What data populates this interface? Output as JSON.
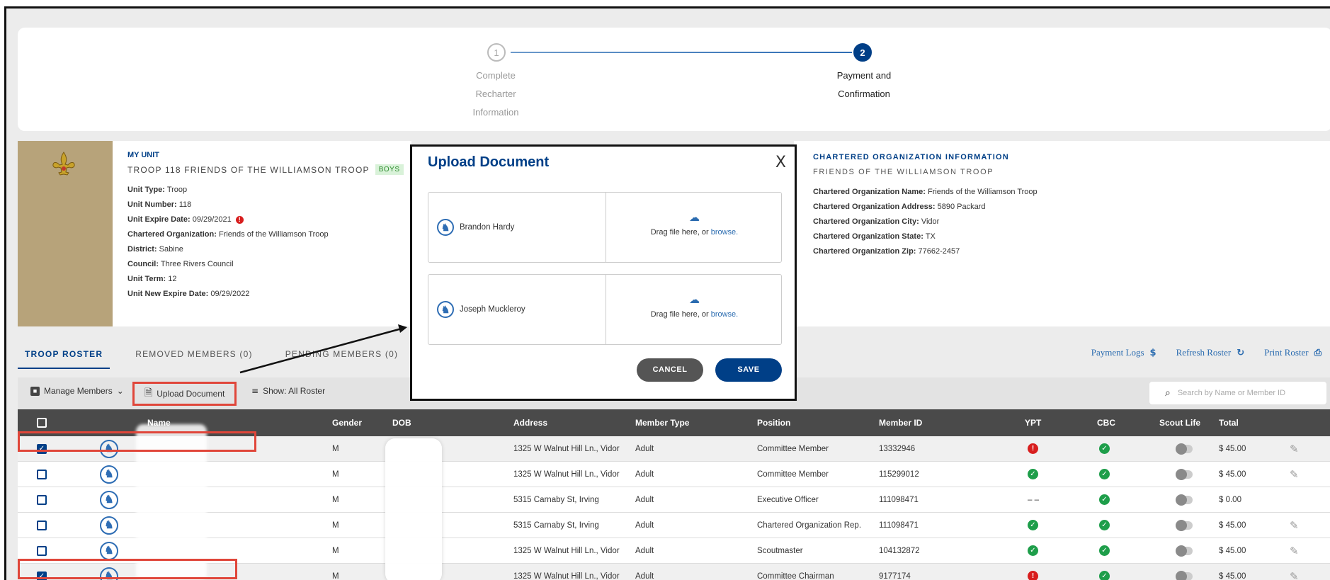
{
  "stepper": {
    "steps": [
      {
        "num": "1",
        "label": "Complete\nRecharter\nInformation"
      },
      {
        "num": "2",
        "label": "Payment and\nConfirmation"
      }
    ]
  },
  "unit": {
    "heading": "MY UNIT",
    "title": "TROOP 118 FRIENDS OF THE WILLIAMSON TROOP",
    "badge": "BOYS",
    "fields": [
      {
        "k": "Unit Type:",
        "v": "Troop"
      },
      {
        "k": "Unit Number:",
        "v": "118"
      },
      {
        "k": "Unit Expire Date:",
        "v": "09/29/2021"
      },
      {
        "k": "Chartered Organization:",
        "v": "Friends of the Williamson Troop"
      },
      {
        "k": "District:",
        "v": "Sabine"
      },
      {
        "k": "Council:",
        "v": "Three Rivers Council"
      },
      {
        "k": "Unit Term:",
        "v": "12"
      },
      {
        "k": "Unit New Expire Date:",
        "v": "09/29/2022"
      }
    ]
  },
  "org": {
    "heading": "CHARTERED ORGANIZATION INFORMATION",
    "subtitle": "FRIENDS OF THE WILLIAMSON TROOP",
    "fields": [
      {
        "k": "Chartered Organization Name:",
        "v": "Friends of the Williamson Troop"
      },
      {
        "k": "Chartered Organization Address:",
        "v": "5890 Packard"
      },
      {
        "k": "Chartered Organization City:",
        "v": "Vidor"
      },
      {
        "k": "Chartered Organization State:",
        "v": "TX"
      },
      {
        "k": "Chartered Organization Zip:",
        "v": "77662-2457"
      }
    ]
  },
  "tabs": {
    "roster": "TROOP ROSTER",
    "removed": "REMOVED MEMBERS (0)",
    "pending": "PENDING MEMBERS (0)"
  },
  "links": {
    "payment_logs": "Payment Logs",
    "refresh_roster": "Refresh Roster",
    "print_roster": "Print Roster"
  },
  "toolbar": {
    "manage_members": "Manage Members",
    "upload_document": "Upload Document",
    "show_roster": "Show: All Roster",
    "search_placeholder": "Search by Name or Member ID"
  },
  "table": {
    "headers": [
      "Name",
      "Gender",
      "DOB",
      "Address",
      "Member Type",
      "Position",
      "Member ID",
      "YPT",
      "CBC",
      "Scout Life",
      "Total"
    ],
    "rows": [
      {
        "checked": true,
        "gender": "M",
        "address": "1325 W Walnut Hill Ln., Vidor",
        "type": "Adult",
        "position": "Committee Member",
        "id": "13332946",
        "ypt": "bad",
        "cbc": "ok",
        "total": "$ 45.00",
        "edit": true
      },
      {
        "checked": false,
        "gender": "M",
        "address": "1325 W Walnut Hill Ln., Vidor",
        "type": "Adult",
        "position": "Committee Member",
        "id": "115299012",
        "ypt": "ok",
        "cbc": "ok",
        "total": "$ 45.00",
        "edit": true
      },
      {
        "checked": false,
        "gender": "M",
        "address": "5315 Carnaby St, Irving",
        "type": "Adult",
        "position": "Executive Officer",
        "id": "111098471",
        "ypt": "dash",
        "cbc": "ok",
        "total": "$ 0.00",
        "edit": false
      },
      {
        "checked": false,
        "gender": "M",
        "address": "5315 Carnaby St, Irving",
        "type": "Adult",
        "position": "Chartered Organization Rep.",
        "id": "111098471",
        "ypt": "ok",
        "cbc": "ok",
        "total": "$ 45.00",
        "edit": true
      },
      {
        "checked": false,
        "gender": "M",
        "address": "1325 W Walnut Hill Ln., Vidor",
        "type": "Adult",
        "position": "Scoutmaster",
        "id": "104132872",
        "ypt": "ok",
        "cbc": "ok",
        "total": "$ 45.00",
        "edit": true
      },
      {
        "checked": true,
        "gender": "M",
        "address": "1325 W Walnut Hill Ln., Vidor",
        "type": "Adult",
        "position": "Committee Chairman",
        "id": "9177174",
        "ypt": "bad",
        "cbc": "ok",
        "total": "$ 45.00",
        "edit": true
      }
    ],
    "ypt_dash": "– –"
  },
  "modal": {
    "title": "Upload Document",
    "close": "X",
    "members": [
      {
        "name": "Brandon Hardy"
      },
      {
        "name": "Joseph Muckleroy"
      }
    ],
    "drag_text": "Drag file here, or ",
    "browse": "browse.",
    "cancel": "CANCEL",
    "save": "SAVE"
  },
  "colors": {
    "brand_blue": "#003f87",
    "link_blue": "#2b6cb0",
    "highlight_red": "#e0463a",
    "ok_green": "#1e9e4a",
    "alert_red": "#d81e1e"
  }
}
